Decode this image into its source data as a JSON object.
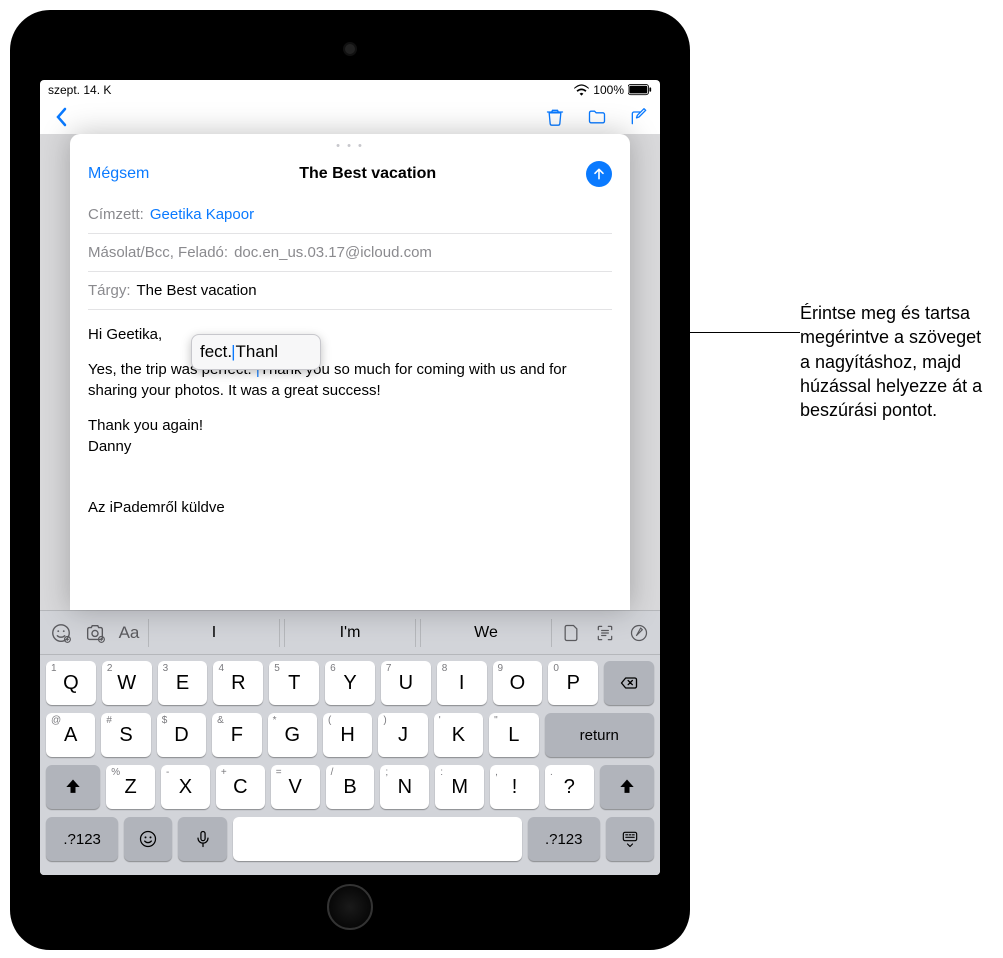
{
  "statusbar": {
    "time": "szept. 14. K",
    "battery_pct": "100%"
  },
  "compose": {
    "cancel": "Mégsem",
    "title": "The Best vacation",
    "to_label": "Címzett:",
    "to_value": "Geetika Kapoor",
    "cc_label": "Másolat/Bcc, Feladó:",
    "cc_value": "doc.en_us.03.17@icloud.com",
    "subject_label": "Tárgy:",
    "subject_value": "The Best vacation",
    "body_greeting": "Hi Geetika,",
    "body_main_pre": "Yes, the trip was perfect. ",
    "body_main_post": "Thank you so much for coming with us and for sharing your photos. It was a great success!",
    "body_closing": "Thank you again!",
    "body_name": "Danny",
    "signature": "Az iPademről küldve",
    "loupe_pre": "fect. ",
    "loupe_post": "Thanl"
  },
  "keyboard": {
    "suggestions": [
      "I",
      "I'm",
      "We"
    ],
    "row1": [
      {
        "main": "Q",
        "sup": "1"
      },
      {
        "main": "W",
        "sup": "2"
      },
      {
        "main": "E",
        "sup": "3"
      },
      {
        "main": "R",
        "sup": "4"
      },
      {
        "main": "T",
        "sup": "5"
      },
      {
        "main": "Y",
        "sup": "6"
      },
      {
        "main": "U",
        "sup": "7"
      },
      {
        "main": "I",
        "sup": "8"
      },
      {
        "main": "O",
        "sup": "9"
      },
      {
        "main": "P",
        "sup": "0"
      }
    ],
    "row2": [
      {
        "main": "A",
        "sup": "@"
      },
      {
        "main": "S",
        "sup": "#"
      },
      {
        "main": "D",
        "sup": "$"
      },
      {
        "main": "F",
        "sup": "&"
      },
      {
        "main": "G",
        "sup": "*"
      },
      {
        "main": "H",
        "sup": "("
      },
      {
        "main": "J",
        "sup": ")"
      },
      {
        "main": "K",
        "sup": "'"
      },
      {
        "main": "L",
        "sup": "\""
      }
    ],
    "row3": [
      {
        "main": "Z",
        "sup": "%"
      },
      {
        "main": "X",
        "sup": "-"
      },
      {
        "main": "C",
        "sup": "+"
      },
      {
        "main": "V",
        "sup": "="
      },
      {
        "main": "B",
        "sup": "/"
      },
      {
        "main": "N",
        "sup": ";"
      },
      {
        "main": "M",
        "sup": ":"
      },
      {
        "main": "!",
        "sup": ","
      },
      {
        "main": "?",
        "sup": "."
      }
    ],
    "return": "return",
    "numkey": ".?123"
  },
  "callout": "Érintse meg és tartsa megérintve a szöveget a nagyításhoz, majd húzással helyezze át a beszúrási pontot."
}
